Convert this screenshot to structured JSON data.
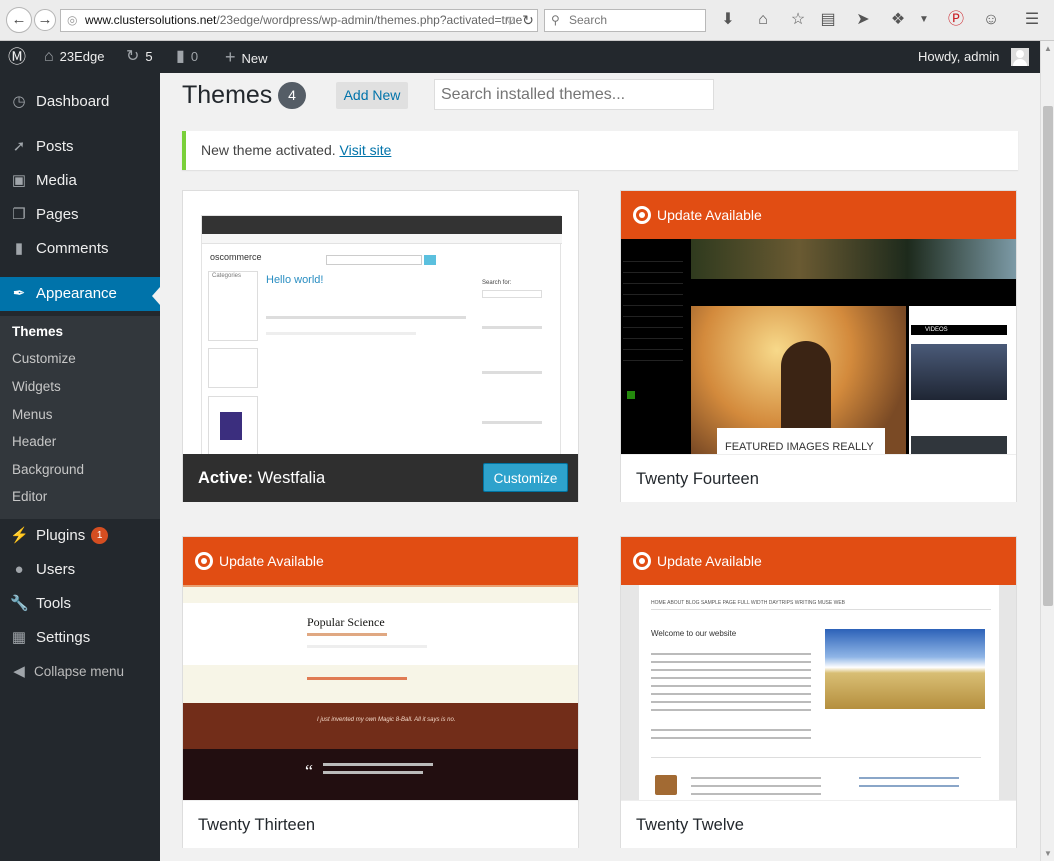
{
  "browser": {
    "url_host": "www.clustersolutions.net",
    "url_path": "/23edge/wordpress/wp-admin/themes.php?activated=true",
    "search_placeholder": "Search"
  },
  "adminbar": {
    "site_name": "23Edge",
    "updates_count": "5",
    "comments_count": "0",
    "new_label": "New",
    "howdy": "Howdy, admin"
  },
  "sidebar": {
    "items": [
      {
        "label": "Dashboard",
        "icon": "dashboard-icon"
      },
      {
        "label": "Posts",
        "icon": "pin-icon"
      },
      {
        "label": "Media",
        "icon": "media-icon"
      },
      {
        "label": "Pages",
        "icon": "pages-icon"
      },
      {
        "label": "Comments",
        "icon": "comment-icon"
      },
      {
        "label": "Appearance",
        "icon": "brush-icon"
      },
      {
        "label": "Plugins",
        "icon": "plug-icon",
        "badge": "1"
      },
      {
        "label": "Users",
        "icon": "user-icon"
      },
      {
        "label": "Tools",
        "icon": "wrench-icon"
      },
      {
        "label": "Settings",
        "icon": "settings-icon"
      }
    ],
    "submenu": [
      "Themes",
      "Customize",
      "Widgets",
      "Menus",
      "Header",
      "Background",
      "Editor"
    ],
    "collapse": "Collapse menu"
  },
  "main": {
    "title": "Themes",
    "count": "4",
    "add_new": "Add New",
    "search_placeholder": "Search installed themes...",
    "notice_text": "New theme activated.",
    "notice_link": "Visit site"
  },
  "themes": [
    {
      "name": "Westfalia",
      "active_label": "Active:",
      "customize": "Customize"
    },
    {
      "name": "Twenty Fourteen",
      "update": "Update Available"
    },
    {
      "name": "Twenty Thirteen",
      "update": "Update Available"
    },
    {
      "name": "Twenty Twelve",
      "update": "Update Available"
    }
  ],
  "previews": {
    "westfalia": {
      "logo": "oscommerce",
      "post_title": "Hello world!",
      "categories": "Categories",
      "search_for": "Search for:"
    },
    "fourteen": {
      "headline": "FEATURED IMAGES REALLY",
      "videos": "VIDEOS"
    },
    "thirteen": {
      "title": "Popular Science",
      "subtitle": "I just invented my own Magic 8-Ball. All it says is no."
    },
    "twelve": {
      "heading": "Welcome to our website",
      "nav": "HOME   ABOUT   BLOG   SAMPLE PAGE   FULL WIDTH   DAYTRIPS   WRITING   MUSE   WEB"
    }
  },
  "colors": {
    "accent": "#0073aa",
    "update": "#e14d13",
    "notice": "#7ad03a",
    "adminbar": "#23282d"
  }
}
